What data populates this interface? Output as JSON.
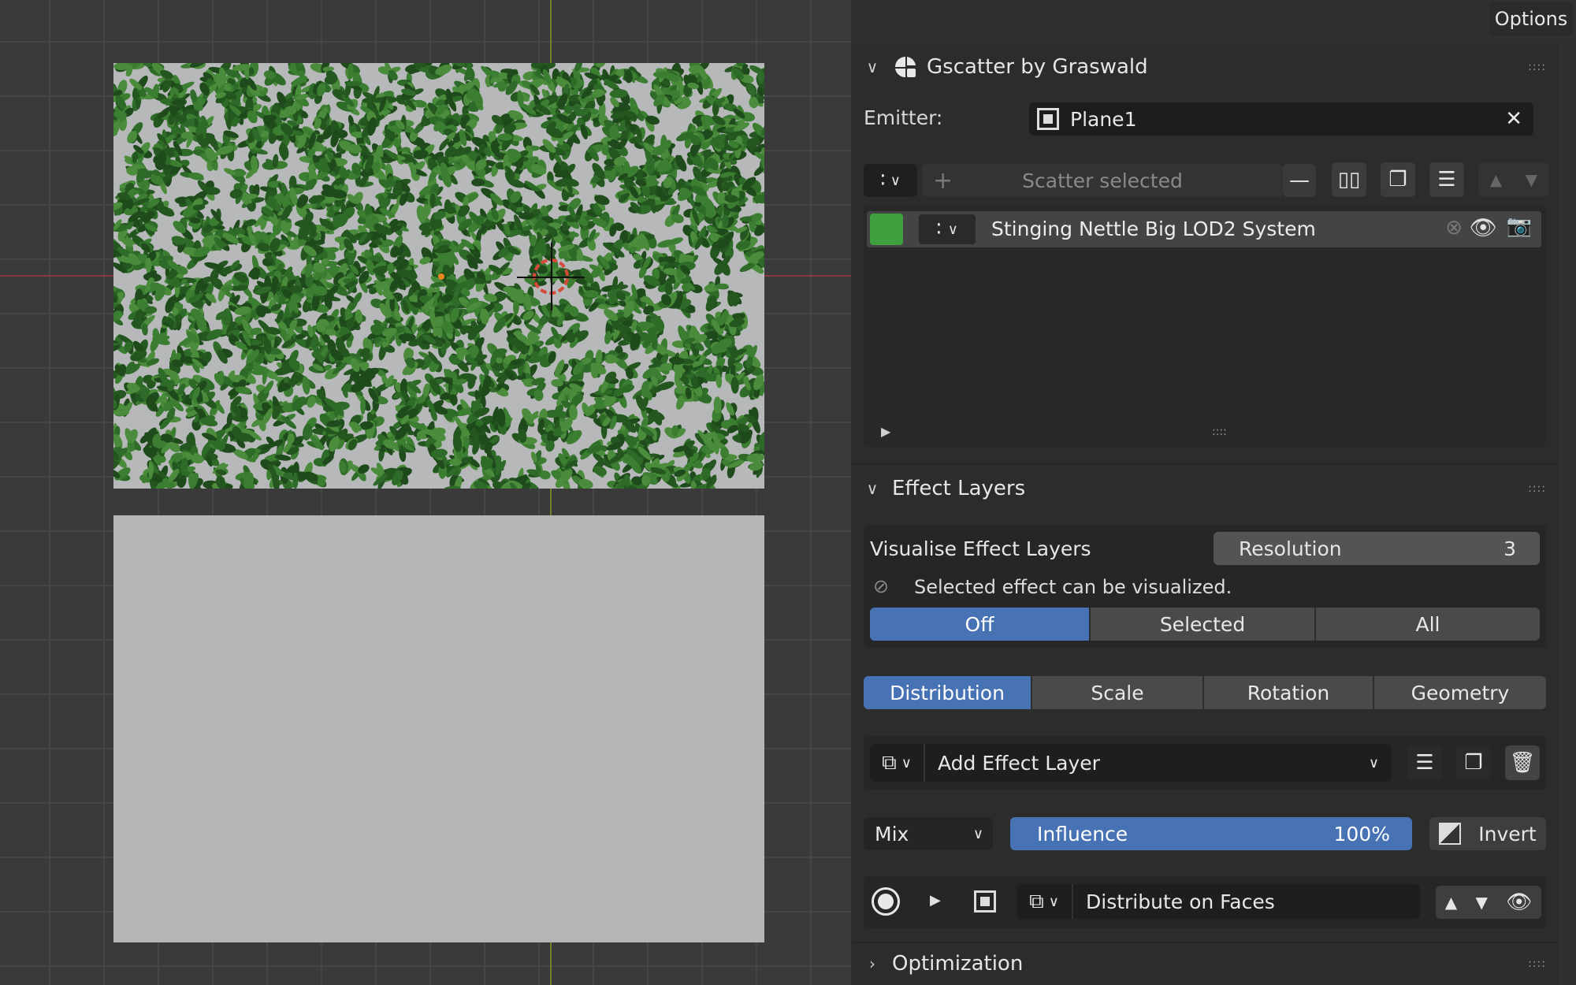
{
  "options_label": "Options",
  "gscatter": {
    "title": "Gscatter by Graswald",
    "emitter_label": "Emitter:",
    "emitter_value": "Plane1",
    "scatter_selected": "Scatter selected",
    "system_name": "Stinging Nettle Big LOD2 System",
    "system_color": "#3fa03f"
  },
  "effect_layers": {
    "title": "Effect Layers",
    "visualise_label": "Visualise Effect Layers",
    "resolution_label": "Resolution",
    "resolution_value": "3",
    "hint": "Selected effect can be visualized.",
    "vis_modes": [
      "Off",
      "Selected",
      "All"
    ],
    "vis_active": "Off",
    "tabs": [
      "Distribution",
      "Scale",
      "Rotation",
      "Geometry"
    ],
    "tab_active": "Distribution",
    "add_layer": "Add Effect Layer",
    "blend_mode": "Mix",
    "influence_label": "Influence",
    "influence_value": "100%",
    "invert_label": "Invert",
    "layer_name": "Distribute on Faces"
  },
  "optimization": {
    "title": "Optimization"
  },
  "colors": {
    "accent": "#4772b3",
    "foliage": "#2f6b2a",
    "plane": "#b7b8ba"
  }
}
